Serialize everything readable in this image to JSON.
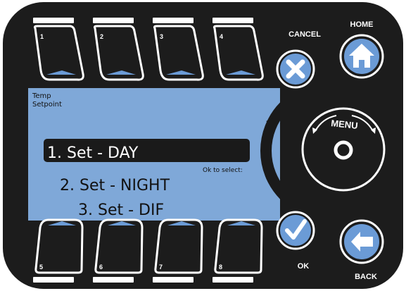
{
  "header": {
    "cancel_label": "CANCEL",
    "home_label": "HOME",
    "ok_label": "OK",
    "back_label": "BACK"
  },
  "softkeys": {
    "top": [
      "1",
      "2",
      "3",
      "4"
    ],
    "bottom": [
      "5",
      "6",
      "7",
      "8"
    ]
  },
  "screen": {
    "title_line1": "Temp",
    "title_line2": "Setpoint",
    "hint": "Ok to select:",
    "items": [
      "1. Set - DAY",
      "2. Set - NIGHT",
      "3. Set - DIF"
    ],
    "selected_index": 0
  },
  "dial": {
    "label": "MENU"
  },
  "colors": {
    "bezel": "#1c1c1c",
    "screen": "#7fa8d8",
    "key_outline": "#ffffff",
    "key_indicator": "#6b9bd6",
    "selection_bar": "#1a1a1a"
  },
  "icons": {
    "cancel": "close-icon",
    "home": "home-icon",
    "ok": "checkmark-icon",
    "back": "arrow-left-icon"
  }
}
